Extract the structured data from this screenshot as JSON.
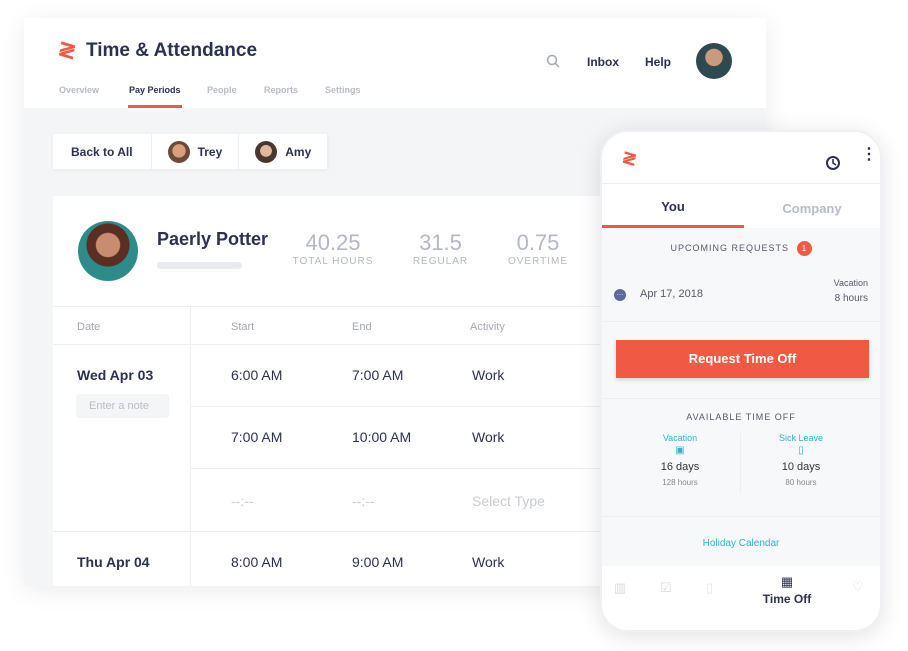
{
  "app": {
    "title": "Time & Attendance",
    "logo": "≷"
  },
  "nav": {
    "tabs": [
      "Overview",
      "Pay Periods",
      "People",
      "Reports",
      "Settings"
    ],
    "active": 1
  },
  "header": {
    "search_icon": "search-icon",
    "inbox": "Inbox",
    "help": "Help"
  },
  "filter": {
    "back": "Back to All",
    "people": [
      "Trey",
      "Amy"
    ]
  },
  "employee": {
    "name": "Paerly Potter",
    "stats": [
      {
        "value": "40.25",
        "label": "TOTAL HOURS"
      },
      {
        "value": "31.5",
        "label": "REGULAR"
      },
      {
        "value": "0.75",
        "label": "OVERTIME"
      }
    ]
  },
  "table": {
    "headers": [
      "Date",
      "Start",
      "End",
      "Activity"
    ],
    "days": [
      {
        "date": "Wed Apr 03",
        "note_placeholder": "Enter a note",
        "rows": [
          [
            "6:00 AM",
            "7:00 AM",
            "Work"
          ],
          [
            "7:00 AM",
            "10:00 AM",
            "Work"
          ],
          [
            "--:--",
            "--:--",
            "Select Type"
          ]
        ]
      },
      {
        "date": "Thu Apr 04",
        "rows": [
          [
            "8:00 AM",
            "9:00 AM",
            "Work"
          ]
        ]
      }
    ]
  },
  "phone": {
    "tabs": [
      "You",
      "Company"
    ],
    "upcoming_label": "UPCOMING REQUESTS",
    "upcoming_count": "1",
    "request": {
      "date": "Apr 17, 2018",
      "type": "Vacation",
      "hours": "8 hours"
    },
    "cta": "Request Time Off",
    "available_label": "AVAILABLE TIME OFF",
    "balances": [
      {
        "type": "Vacation",
        "days": "16 days",
        "hours": "128 hours"
      },
      {
        "type": "Sick Leave",
        "days": "10 days",
        "hours": "80 hours"
      }
    ],
    "holiday": "Holiday Calendar",
    "bottom_nav_active": "Time Off",
    "colors": {
      "accent": "#f05a45",
      "teal": "#2fb4c8",
      "navy": "#2c3150"
    }
  }
}
